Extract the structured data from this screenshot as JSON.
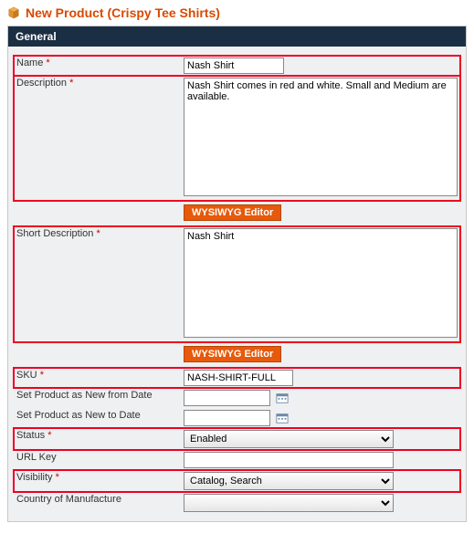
{
  "page": {
    "title": "New Product (Crispy Tee Shirts)"
  },
  "panel": {
    "title": "General"
  },
  "fields": {
    "name": {
      "label": "Name",
      "req": "*",
      "value": "Nash Shirt"
    },
    "description": {
      "label": "Description",
      "req": "*",
      "value": "Nash Shirt comes in red and white. Small and Medium are available."
    },
    "short_desc": {
      "label": "Short Description",
      "req": "*",
      "value": "Nash Shirt"
    },
    "sku": {
      "label": "SKU",
      "req": "*",
      "value": "NASH-SHIRT-FULL"
    },
    "new_from": {
      "label": "Set Product as New from Date",
      "value": ""
    },
    "new_to": {
      "label": "Set Product as New to Date",
      "value": ""
    },
    "status": {
      "label": "Status",
      "req": "*",
      "selected": "Enabled"
    },
    "url_key": {
      "label": "URL Key",
      "value": ""
    },
    "visibility": {
      "label": "Visibility",
      "req": "*",
      "selected": "Catalog, Search"
    },
    "country": {
      "label": "Country of Manufacture",
      "selected": ""
    }
  },
  "buttons": {
    "wysiwyg": "WYSIWYG Editor"
  }
}
